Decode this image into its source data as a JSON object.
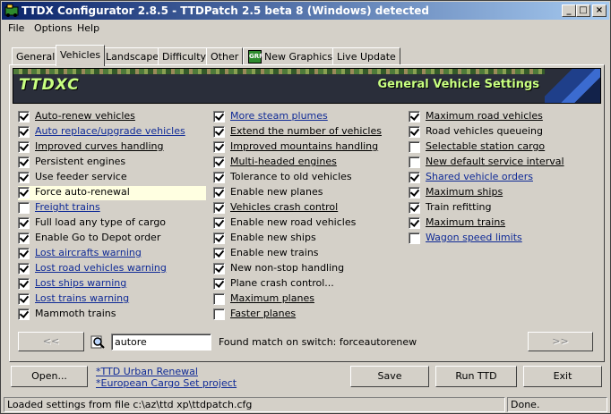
{
  "window": {
    "title": "TTDX Configurator 2.8.5 - TTDPatch 2.5 beta 8 (Windows) detected"
  },
  "menubar": [
    {
      "label": "File"
    },
    {
      "label": "Options"
    },
    {
      "label": "Help"
    }
  ],
  "tabs": [
    {
      "label": "General"
    },
    {
      "label": "Vehicles"
    },
    {
      "label": "Landscape"
    },
    {
      "label": "Difficulty"
    },
    {
      "label": "Other"
    },
    {
      "label": "New Graphics"
    },
    {
      "label": "Live Update"
    }
  ],
  "banner": {
    "logo": "TTDXC",
    "heading": "General Vehicle Settings"
  },
  "options": {
    "col1": [
      {
        "label": "Auto-renew vehicles",
        "checked": true,
        "style": "plain-u"
      },
      {
        "label": "Auto replace/upgrade vehicles",
        "checked": true,
        "style": "link"
      },
      {
        "label": "Improved curves handling",
        "checked": true,
        "style": "plain-u"
      },
      {
        "label": "Persistent engines",
        "checked": true,
        "style": "none"
      },
      {
        "label": "Use feeder service",
        "checked": true,
        "style": "none"
      },
      {
        "label": "Force auto-renewal",
        "checked": true,
        "style": "none"
      },
      {
        "label": "Freight trains",
        "checked": false,
        "style": "link"
      },
      {
        "label": "Full load any type of cargo",
        "checked": true,
        "style": "none"
      },
      {
        "label": "Enable Go to Depot order",
        "checked": true,
        "style": "none"
      },
      {
        "label": "Lost aircrafts warning",
        "checked": true,
        "style": "link"
      },
      {
        "label": "Lost road vehicles warning",
        "checked": true,
        "style": "link"
      },
      {
        "label": "Lost ships warning",
        "checked": true,
        "style": "link"
      },
      {
        "label": "Lost trains warning",
        "checked": true,
        "style": "link"
      },
      {
        "label": "Mammoth trains",
        "checked": true,
        "style": "none"
      }
    ],
    "col2": [
      {
        "label": "More steam plumes",
        "checked": true,
        "style": "link"
      },
      {
        "label": "Extend the number of vehicles",
        "checked": true,
        "style": "plain-u"
      },
      {
        "label": "Improved mountains handling",
        "checked": true,
        "style": "plain-u"
      },
      {
        "label": "Multi-headed engines",
        "checked": true,
        "style": "plain-u"
      },
      {
        "label": "Tolerance to old vehicles",
        "checked": true,
        "style": "none"
      },
      {
        "label": "Enable new planes",
        "checked": true,
        "style": "none"
      },
      {
        "label": "Vehicles crash control",
        "checked": true,
        "style": "plain-u"
      },
      {
        "label": "Enable new road vehicles",
        "checked": true,
        "style": "none"
      },
      {
        "label": "Enable new ships",
        "checked": true,
        "style": "none"
      },
      {
        "label": "Enable new trains",
        "checked": true,
        "style": "none"
      },
      {
        "label": "New non-stop handling",
        "checked": true,
        "style": "none"
      },
      {
        "label": "Plane crash control...",
        "checked": true,
        "style": "none"
      },
      {
        "label": "Maximum planes",
        "checked": false,
        "style": "plain-u"
      },
      {
        "label": "Faster planes",
        "checked": false,
        "style": "plain-u"
      }
    ],
    "col3": [
      {
        "label": "Maximum road vehicles",
        "checked": true,
        "style": "plain-u"
      },
      {
        "label": "Road vehicles queueing",
        "checked": true,
        "style": "none"
      },
      {
        "label": "Selectable station cargo",
        "checked": false,
        "style": "plain-u"
      },
      {
        "label": "New default service interval",
        "checked": false,
        "style": "plain-u"
      },
      {
        "label": "Shared vehicle orders",
        "checked": true,
        "style": "link"
      },
      {
        "label": "Maximum ships",
        "checked": true,
        "style": "plain-u"
      },
      {
        "label": "Train refitting",
        "checked": true,
        "style": "none"
      },
      {
        "label": "Maximum trains",
        "checked": true,
        "style": "plain-u"
      },
      {
        "label": "Wagon speed limits",
        "checked": false,
        "style": "link"
      }
    ]
  },
  "search": {
    "prev_label": "<<",
    "next_label": ">>",
    "value": "autore",
    "result": "Found match on switch: forceautorenew"
  },
  "buttons": {
    "open": "Open...",
    "save": "Save",
    "run": "Run TTD",
    "exit": "Exit"
  },
  "links": [
    "*TTD Urban Renewal",
    "*European Cargo Set project"
  ],
  "status": {
    "left": "Loaded settings from file c:\\az\\ttd xp\\ttdpatch.cfg",
    "right": "Done."
  }
}
